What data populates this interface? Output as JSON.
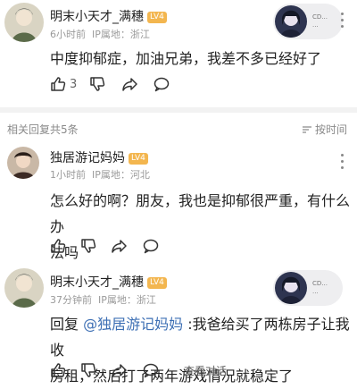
{
  "comments": [
    {
      "author": "明末小天才_满穗",
      "level": "LV4",
      "time": "6小时前",
      "location": "IP属地：浙江",
      "content": "中度抑郁症，加油兄弟，我差不多已经好了",
      "likes": "3",
      "badge_text": [
        "CD...",
        "..."
      ]
    },
    {
      "author": "独居游记妈妈",
      "level": "LV4",
      "time": "1小时前",
      "location": "IP属地：河北",
      "content_line1": "怎么好的啊？朋友，我也是抑郁很严重，有什么办",
      "content_line2": "法吗"
    },
    {
      "author": "明末小天才_满穗",
      "level": "LV4",
      "time": "37分钟前",
      "location": "IP属地：浙江",
      "content_prefix": "回复 ",
      "mention": "@独居游记妈妈",
      "content_line1_rest": " :我爸给买了两栋房子让我收",
      "content_line2": "房租，然后打了两年游戏情况就稳定了",
      "view_replies": "查看对话",
      "badge_text": [
        "CD...",
        "..."
      ]
    }
  ],
  "replies_section": {
    "title": "相关回复共5条",
    "sort_label": "按时间"
  },
  "colors": {
    "level_badge": "#f3b64f",
    "mention": "#3d6fb4",
    "meta": "#9a9a9a",
    "divider": "#f2f2f2"
  }
}
